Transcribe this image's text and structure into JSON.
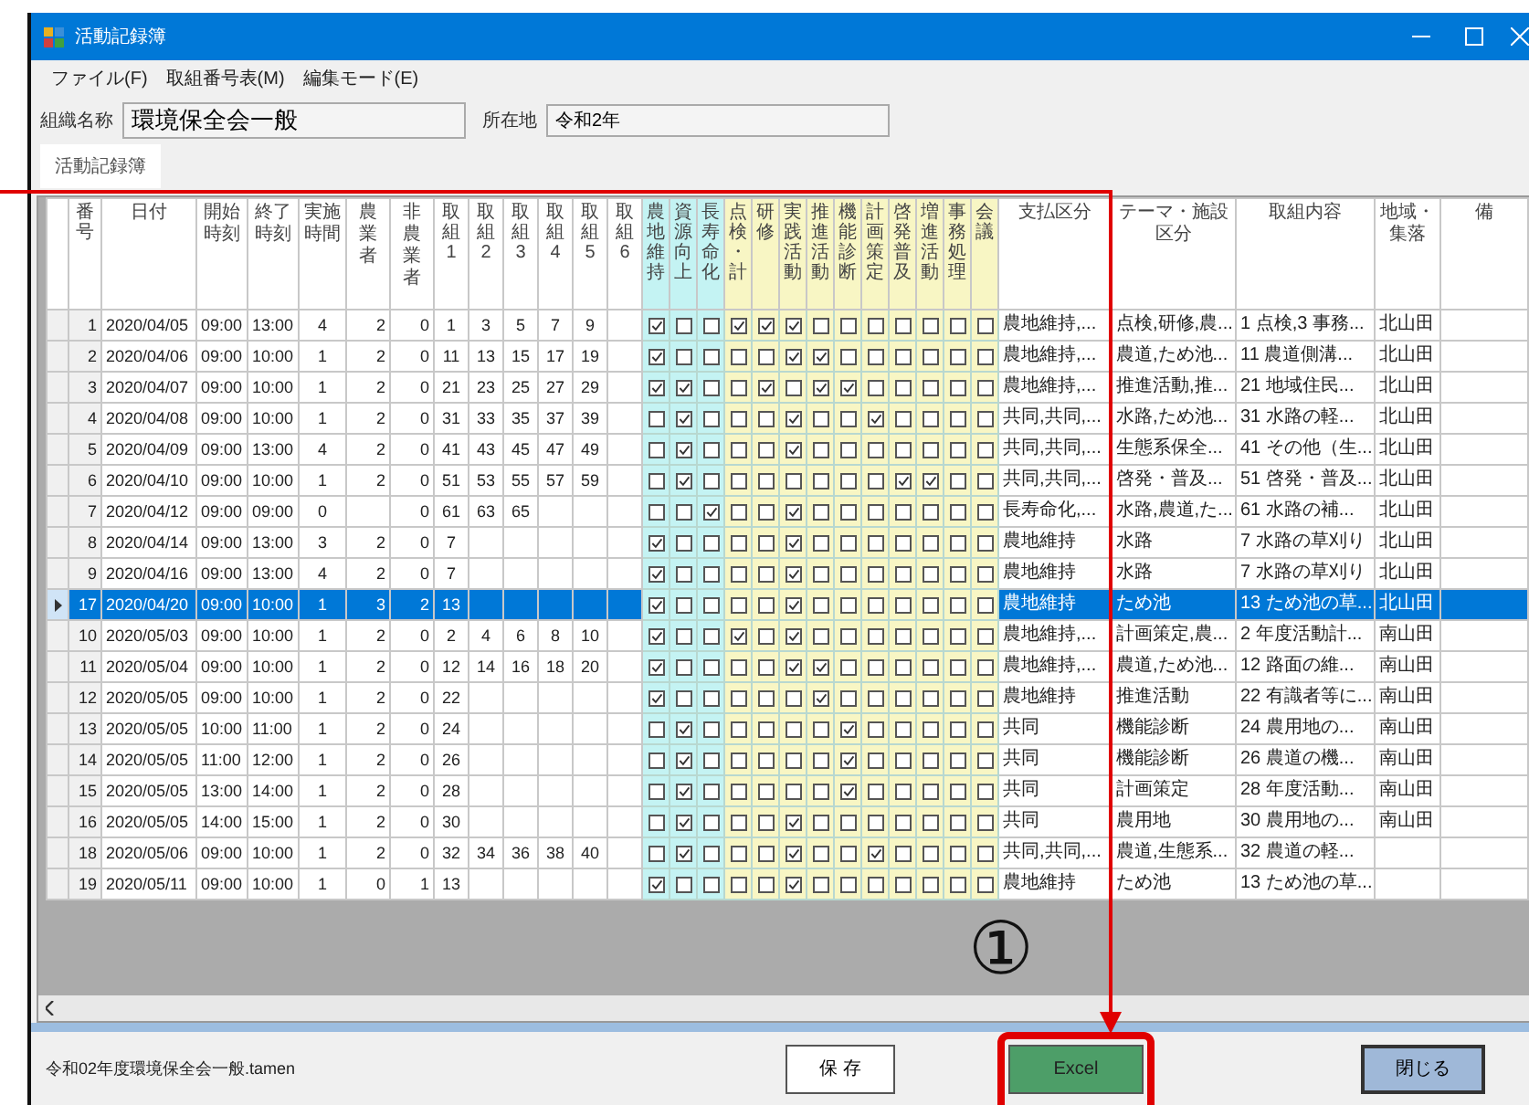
{
  "window": {
    "title": "活動記録簿"
  },
  "menu": [
    {
      "label": "ファイル(F)"
    },
    {
      "label": "取組番号表(M)"
    },
    {
      "label": "編集モード(E)"
    }
  ],
  "organization": {
    "label": "組織名称",
    "value": "環境保全会一般"
  },
  "location": {
    "label": "所在地",
    "value": "令和2年"
  },
  "tabs": [
    {
      "label": "活動記録簿",
      "selected": true
    }
  ],
  "table": {
    "columns": [
      {
        "label": "番号",
        "kind": "index"
      },
      {
        "label": "日付",
        "kind": "date"
      },
      {
        "label": "開始時刻",
        "kind": "time"
      },
      {
        "label": "終了時刻",
        "kind": "time"
      },
      {
        "label": "実施時間",
        "kind": "count"
      },
      {
        "label": "農業者",
        "kind": "right"
      },
      {
        "label": "非農業者",
        "kind": "right"
      },
      {
        "label": "取組1",
        "kind": "number"
      },
      {
        "label": "取組2",
        "kind": "number"
      },
      {
        "label": "取組3",
        "kind": "number"
      },
      {
        "label": "取組4",
        "kind": "number"
      },
      {
        "label": "取組5",
        "kind": "number"
      },
      {
        "label": "取組6",
        "kind": "number"
      },
      {
        "label": "農地維持",
        "kind": "check",
        "color": "#c4f3f3"
      },
      {
        "label": "資源向上",
        "kind": "check",
        "color": "#c4f3f3"
      },
      {
        "label": "長寿命化",
        "kind": "check",
        "color": "#c4f3f3"
      },
      {
        "label": "点検・計",
        "kind": "check",
        "color": "#f8f6c4"
      },
      {
        "label": "研修",
        "kind": "check",
        "color": "#f8f6c4"
      },
      {
        "label": "実践活動",
        "kind": "check",
        "color": "#f8f6c4"
      },
      {
        "label": "推進活動",
        "kind": "check",
        "color": "#f8f6c4"
      },
      {
        "label": "機能診断",
        "kind": "check",
        "color": "#f8f6c4"
      },
      {
        "label": "計画策定",
        "kind": "check",
        "color": "#f8f6c4"
      },
      {
        "label": "啓発普及",
        "kind": "check",
        "color": "#f8f6c4"
      },
      {
        "label": "増進活動",
        "kind": "check",
        "color": "#f8f6c4"
      },
      {
        "label": "事務処理",
        "kind": "check",
        "color": "#f8f6c4"
      },
      {
        "label": "会議",
        "kind": "check",
        "color": "#f8f6c4"
      },
      {
        "label": "支払区分",
        "kind": "text"
      },
      {
        "label": "テーマ・施設区分",
        "kind": "text"
      },
      {
        "label": "取組内容",
        "kind": "text"
      },
      {
        "label": "地域・集落",
        "kind": "text"
      },
      {
        "label": "備",
        "kind": "text"
      }
    ],
    "rows": [
      {
        "selected": false,
        "cells": [
          "1",
          "2020/04/05",
          "09:00",
          "13:00",
          "4",
          "2",
          "0",
          "1",
          "3",
          "5",
          "7",
          "9",
          null,
          true,
          false,
          false,
          true,
          true,
          true,
          false,
          false,
          false,
          false,
          false,
          false,
          false,
          "農地維持,...",
          "点検,研修,農...",
          "1 点検,3 事務...",
          "北山田"
        ]
      },
      {
        "selected": false,
        "cells": [
          "2",
          "2020/04/06",
          "09:00",
          "10:00",
          "1",
          "2",
          "0",
          "11",
          "13",
          "15",
          "17",
          "19",
          null,
          true,
          false,
          false,
          false,
          false,
          true,
          true,
          false,
          false,
          false,
          false,
          false,
          false,
          "農地維持,...",
          "農道,ため池...",
          "11 農道側溝...",
          "北山田"
        ]
      },
      {
        "selected": false,
        "cells": [
          "3",
          "2020/04/07",
          "09:00",
          "10:00",
          "1",
          "2",
          "0",
          "21",
          "23",
          "25",
          "27",
          "29",
          null,
          true,
          true,
          false,
          false,
          true,
          false,
          true,
          true,
          false,
          false,
          false,
          false,
          false,
          "農地維持,...",
          "推進活動,推...",
          "21 地域住民...",
          "北山田"
        ]
      },
      {
        "selected": false,
        "cells": [
          "4",
          "2020/04/08",
          "09:00",
          "10:00",
          "1",
          "2",
          "0",
          "31",
          "33",
          "35",
          "37",
          "39",
          null,
          false,
          true,
          false,
          false,
          false,
          true,
          false,
          false,
          true,
          false,
          false,
          false,
          false,
          "共同,共同,...",
          "水路,ため池...",
          "31 水路の軽...",
          "北山田"
        ]
      },
      {
        "selected": false,
        "cells": [
          "5",
          "2020/04/09",
          "09:00",
          "13:00",
          "4",
          "2",
          "0",
          "41",
          "43",
          "45",
          "47",
          "49",
          null,
          false,
          true,
          false,
          false,
          false,
          true,
          false,
          false,
          false,
          false,
          false,
          false,
          false,
          "共同,共同,...",
          "生態系保全...",
          "41 その他（生...",
          "北山田"
        ]
      },
      {
        "selected": false,
        "cells": [
          "6",
          "2020/04/10",
          "09:00",
          "10:00",
          "1",
          "2",
          "0",
          "51",
          "53",
          "55",
          "57",
          "59",
          null,
          false,
          true,
          false,
          false,
          false,
          false,
          false,
          false,
          false,
          true,
          true,
          false,
          false,
          "共同,共同,...",
          "啓発・普及...",
          "51 啓発・普及...",
          "北山田"
        ]
      },
      {
        "selected": false,
        "cells": [
          "7",
          "2020/04/12",
          "09:00",
          "09:00",
          "0",
          null,
          "0",
          "61",
          "63",
          "65",
          null,
          null,
          null,
          false,
          false,
          true,
          false,
          false,
          true,
          false,
          false,
          false,
          false,
          false,
          false,
          false,
          "長寿命化,...",
          "水路,農道,た...",
          "61 水路の補...",
          "北山田"
        ]
      },
      {
        "selected": false,
        "cells": [
          "8",
          "2020/04/14",
          "09:00",
          "13:00",
          "3",
          "2",
          "0",
          "7",
          null,
          null,
          null,
          null,
          null,
          true,
          false,
          false,
          false,
          false,
          true,
          false,
          false,
          false,
          false,
          false,
          false,
          false,
          "農地維持",
          "水路",
          "7 水路の草刈り",
          "北山田"
        ]
      },
      {
        "selected": false,
        "cells": [
          "9",
          "2020/04/16",
          "09:00",
          "13:00",
          "4",
          "2",
          "0",
          "7",
          null,
          null,
          null,
          null,
          null,
          true,
          false,
          false,
          false,
          false,
          true,
          false,
          false,
          false,
          false,
          false,
          false,
          false,
          "農地維持",
          "水路",
          "7 水路の草刈り",
          "北山田"
        ]
      },
      {
        "selected": true,
        "cells": [
          "17",
          "2020/04/20",
          "09:00",
          "10:00",
          "1",
          "3",
          "2",
          "13",
          null,
          null,
          null,
          null,
          null,
          true,
          false,
          false,
          false,
          false,
          true,
          false,
          false,
          false,
          false,
          false,
          false,
          false,
          "農地維持",
          "ため池",
          "13 ため池の草...",
          "北山田"
        ]
      },
      {
        "selected": false,
        "cells": [
          "10",
          "2020/05/03",
          "09:00",
          "10:00",
          "1",
          "2",
          "0",
          "2",
          "4",
          "6",
          "8",
          "10",
          null,
          true,
          false,
          false,
          true,
          false,
          true,
          false,
          false,
          false,
          false,
          false,
          false,
          false,
          "農地維持,...",
          "計画策定,農...",
          "2 年度活動計...",
          "南山田"
        ]
      },
      {
        "selected": false,
        "cells": [
          "11",
          "2020/05/04",
          "09:00",
          "10:00",
          "1",
          "2",
          "0",
          "12",
          "14",
          "16",
          "18",
          "20",
          null,
          true,
          false,
          false,
          false,
          false,
          true,
          true,
          false,
          false,
          false,
          false,
          false,
          false,
          "農地維持,...",
          "農道,ため池...",
          "12 路面の維...",
          "南山田"
        ]
      },
      {
        "selected": false,
        "cells": [
          "12",
          "2020/05/05",
          "09:00",
          "10:00",
          "1",
          "2",
          "0",
          "22",
          null,
          null,
          null,
          null,
          null,
          true,
          false,
          false,
          false,
          false,
          false,
          true,
          false,
          false,
          false,
          false,
          false,
          false,
          "農地維持",
          "推進活動",
          "22 有識者等に...",
          "南山田"
        ]
      },
      {
        "selected": false,
        "cells": [
          "13",
          "2020/05/05",
          "10:00",
          "11:00",
          "1",
          "2",
          "0",
          "24",
          null,
          null,
          null,
          null,
          null,
          false,
          true,
          false,
          false,
          false,
          false,
          false,
          true,
          false,
          false,
          false,
          false,
          false,
          "共同",
          "機能診断",
          "24 農用地の...",
          "南山田"
        ]
      },
      {
        "selected": false,
        "cells": [
          "14",
          "2020/05/05",
          "11:00",
          "12:00",
          "1",
          "2",
          "0",
          "26",
          null,
          null,
          null,
          null,
          null,
          false,
          true,
          false,
          false,
          false,
          false,
          false,
          true,
          false,
          false,
          false,
          false,
          false,
          "共同",
          "機能診断",
          "26 農道の機...",
          "南山田"
        ]
      },
      {
        "selected": false,
        "cells": [
          "15",
          "2020/05/05",
          "13:00",
          "14:00",
          "1",
          "2",
          "0",
          "28",
          null,
          null,
          null,
          null,
          null,
          false,
          true,
          false,
          false,
          false,
          false,
          false,
          true,
          false,
          false,
          false,
          false,
          false,
          "共同",
          "計画策定",
          "28 年度活動...",
          "南山田"
        ]
      },
      {
        "selected": false,
        "cells": [
          "16",
          "2020/05/05",
          "14:00",
          "15:00",
          "1",
          "2",
          "0",
          "30",
          null,
          null,
          null,
          null,
          null,
          false,
          true,
          false,
          false,
          false,
          true,
          false,
          false,
          false,
          false,
          false,
          false,
          false,
          "共同",
          "農用地",
          "30 農用地の...",
          "南山田"
        ]
      },
      {
        "selected": false,
        "cells": [
          "18",
          "2020/05/06",
          "09:00",
          "10:00",
          "1",
          "2",
          "0",
          "32",
          "34",
          "36",
          "38",
          "40",
          null,
          false,
          true,
          false,
          false,
          false,
          true,
          false,
          false,
          true,
          false,
          false,
          false,
          false,
          "共同,共同,...",
          "農道,生態系...",
          "32 農道の軽...",
          null
        ]
      },
      {
        "selected": false,
        "cells": [
          "19",
          "2020/05/11",
          "09:00",
          "10:00",
          "1",
          "0",
          "1",
          "13",
          null,
          null,
          null,
          null,
          null,
          true,
          false,
          false,
          false,
          false,
          true,
          false,
          false,
          false,
          false,
          false,
          false,
          false,
          "農地維持",
          "ため池",
          "13 ため池の草...",
          null
        ]
      }
    ]
  },
  "status_bar": {
    "file": "令和02年度環境保全会一般.tamen",
    "buttons": [
      {
        "label": "保 存",
        "kind": "plain"
      },
      {
        "label": "Excel",
        "kind": "excel"
      },
      {
        "label": "閉じる",
        "kind": "close"
      }
    ]
  },
  "annotation": {
    "label": "①"
  }
}
